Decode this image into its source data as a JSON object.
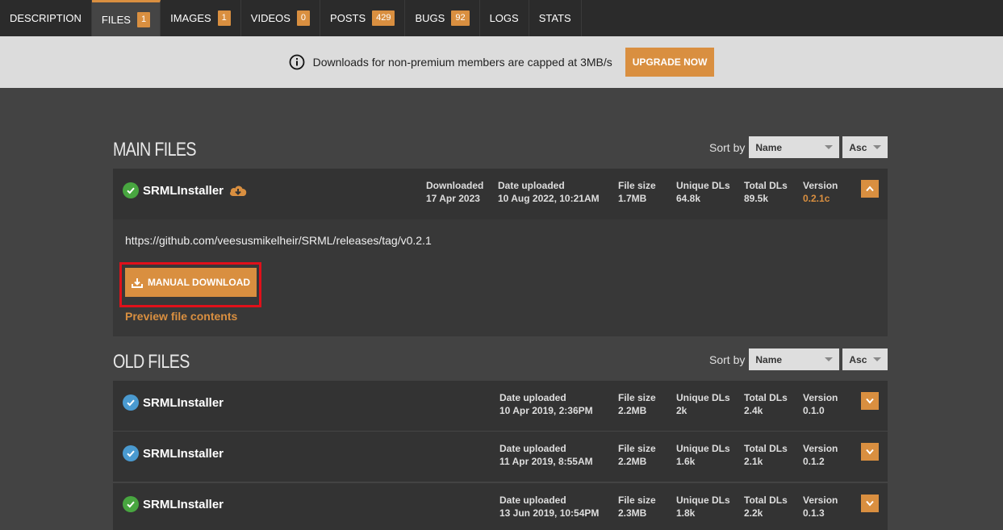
{
  "tabs": [
    {
      "label": "DESCRIPTION",
      "badge": null
    },
    {
      "label": "FILES",
      "badge": "1",
      "active": true
    },
    {
      "label": "IMAGES",
      "badge": "1"
    },
    {
      "label": "VIDEOS",
      "badge": "0"
    },
    {
      "label": "POSTS",
      "badge": "429"
    },
    {
      "label": "BUGS",
      "badge": "92"
    },
    {
      "label": "LOGS",
      "badge": null
    },
    {
      "label": "STATS",
      "badge": null
    }
  ],
  "banner": {
    "message": "Downloads for non-premium members are capped at 3MB/s",
    "upgrade_label": "UPGRADE NOW"
  },
  "main_files": {
    "title": "MAIN FILES",
    "sort_label": "Sort by",
    "sort_field": "Name",
    "sort_dir": "Asc",
    "file": {
      "name": "SRMLInstaller",
      "downloaded_label": "Downloaded",
      "downloaded": "17 Apr 2023",
      "date_label": "Date uploaded",
      "date": "10 Aug 2022, 10:21AM",
      "size_label": "File size",
      "size": "1.7MB",
      "unique_label": "Unique DLs",
      "unique": "64.8k",
      "total_label": "Total DLs",
      "total": "89.5k",
      "version_label": "Version",
      "version": "0.2.1c",
      "link": "https://github.com/veesusmikelheir/SRML/releases/tag/v0.2.1",
      "download_label": "MANUAL DOWNLOAD",
      "preview_label": "Preview file contents"
    }
  },
  "old_files": {
    "title": "OLD FILES",
    "sort_label": "Sort by",
    "sort_field": "Name",
    "sort_dir": "Asc",
    "files": [
      {
        "name": "SRMLInstaller",
        "date_label": "Date uploaded",
        "date": "10 Apr 2019, 2:36PM",
        "size_label": "File size",
        "size": "2.2MB",
        "unique_label": "Unique DLs",
        "unique": "2k",
        "total_label": "Total DLs",
        "total": "2.4k",
        "version_label": "Version",
        "version": "0.1.0",
        "check": "blue"
      },
      {
        "name": "SRMLInstaller",
        "date_label": "Date uploaded",
        "date": "11 Apr 2019, 8:55AM",
        "size_label": "File size",
        "size": "2.2MB",
        "unique_label": "Unique DLs",
        "unique": "1.6k",
        "total_label": "Total DLs",
        "total": "2.1k",
        "version_label": "Version",
        "version": "0.1.2",
        "check": "blue"
      },
      {
        "name": "SRMLInstaller",
        "date_label": "Date uploaded",
        "date": "13 Jun 2019, 10:54PM",
        "size_label": "File size",
        "size": "2.3MB",
        "unique_label": "Unique DLs",
        "unique": "1.8k",
        "total_label": "Total DLs",
        "total": "2.2k",
        "version_label": "Version",
        "version": "0.1.3",
        "check": "green"
      }
    ]
  },
  "colors": {
    "accent": "#d98f40",
    "highlight": "#e0101a",
    "check_green": "#48a640",
    "check_blue": "#4a9ad0"
  }
}
